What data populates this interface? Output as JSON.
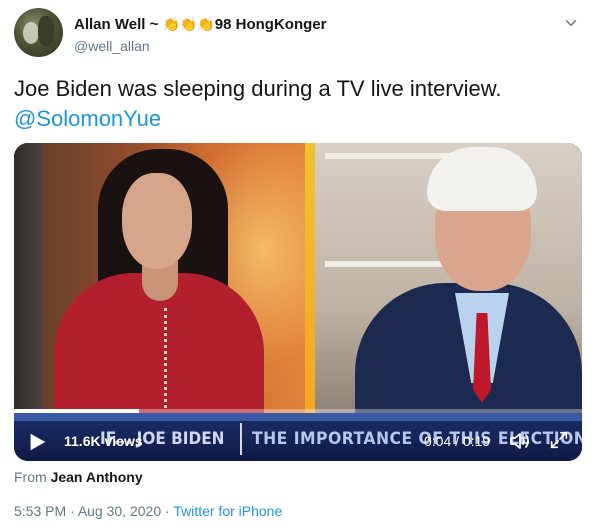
{
  "user": {
    "display_name_prefix": "Allan Well ~ ",
    "emoji": "👏👏👏",
    "display_name_suffix": "98 HongKonger",
    "handle": "@well_allan"
  },
  "tweet": {
    "text": "Joe Biden was sleeping during a TV live interview.",
    "mention": "@SolomonYue"
  },
  "video": {
    "views": "11.6K views",
    "time": "0:04 / 0:19",
    "progress": 0.22,
    "ticker_left": "IF... JOE BIDEN",
    "ticker_right": "THE IMPORTANCE OF THIS ELECTION",
    "accent_color": "#f2c230"
  },
  "attribution": {
    "prefix": "From ",
    "source": "Jean Anthony"
  },
  "meta": {
    "time": "5:53 PM",
    "separator": " · ",
    "date": "Aug 30, 2020",
    "client": "Twitter for iPhone"
  },
  "colors": {
    "link": "#1b95e0",
    "secondary_text": "#657786",
    "primary_text": "#14171a"
  }
}
